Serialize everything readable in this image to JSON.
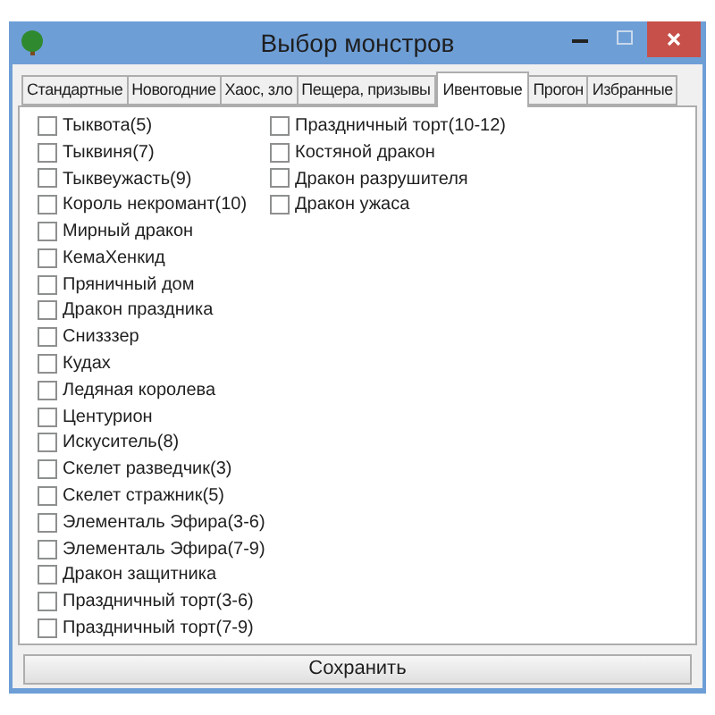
{
  "window": {
    "title": "Выбор монстров"
  },
  "tabs": [
    {
      "label": "Стандартные",
      "selected": false
    },
    {
      "label": "Новогодние",
      "selected": false
    },
    {
      "label": "Хаос, зло",
      "selected": false
    },
    {
      "label": "Пещера, призывы",
      "selected": false
    },
    {
      "label": "Ивентовые",
      "selected": true
    },
    {
      "label": "Прогон",
      "selected": false
    },
    {
      "label": "Избранные",
      "selected": false
    }
  ],
  "columns": [
    [
      {
        "label": "Тыквота(5)",
        "checked": false
      },
      {
        "label": "Тыквиня(7)",
        "checked": false
      },
      {
        "label": "Тыквеужасть(9)",
        "checked": false
      },
      {
        "label": "Король некромант(10)",
        "checked": false
      },
      {
        "label": "Мирный дракон",
        "checked": false
      },
      {
        "label": "КемаХенкид",
        "checked": false
      },
      {
        "label": "Пряничный дом",
        "checked": false
      },
      {
        "label": "Дракон праздника",
        "checked": false
      },
      {
        "label": "Снизззер",
        "checked": false
      },
      {
        "label": "Кудах",
        "checked": false
      },
      {
        "label": "Ледяная королева",
        "checked": false
      },
      {
        "label": "Центурион",
        "checked": false
      },
      {
        "label": "Искуситель(8)",
        "checked": false
      },
      {
        "label": "Скелет разведчик(3)",
        "checked": false
      },
      {
        "label": "Скелет стражник(5)",
        "checked": false
      },
      {
        "label": "Элементаль Эфира(3-6)",
        "checked": false
      },
      {
        "label": "Элементаль Эфира(7-9)",
        "checked": false
      },
      {
        "label": "Дракон защитника",
        "checked": false
      },
      {
        "label": "Праздничный торт(3-6)",
        "checked": false
      },
      {
        "label": "Праздничный торт(7-9)",
        "checked": false
      }
    ],
    [
      {
        "label": "Праздничный торт(10-12)",
        "checked": false
      },
      {
        "label": "Костяной дракон",
        "checked": false
      },
      {
        "label": "Дракон разрушителя",
        "checked": false
      },
      {
        "label": "Дракон ужаса",
        "checked": false
      }
    ]
  ],
  "save_button": "Сохранить"
}
